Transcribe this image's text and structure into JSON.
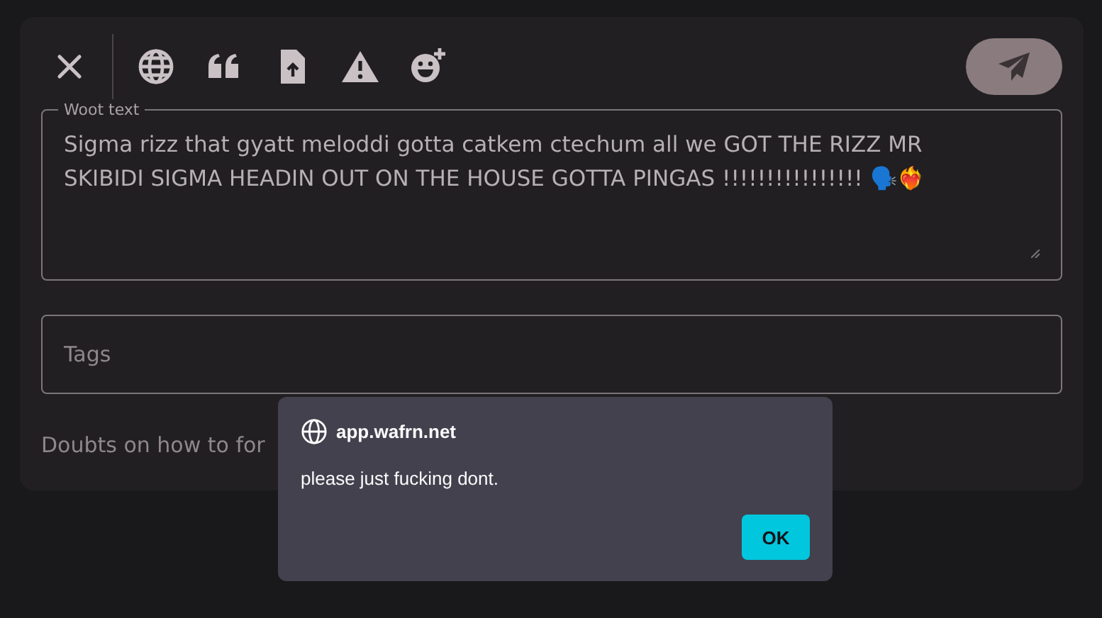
{
  "editor": {
    "text_label": "Woot text",
    "text": "Sigma rizz that gyatt meloddi gotta catkem ctechum all we GOT THE RIZZ MR SKIBIDI SIGMA HEADIN OUT ON THE HOUSE GOTTA PINGAS !!!!!!!!!!!!!!!! 🗣️❤️‍🔥",
    "tags_placeholder": "Tags",
    "help_text": "Doubts on how to for"
  },
  "dialog": {
    "origin": "app.wafrn.net",
    "message": "please just fucking dont.",
    "button": "OK"
  }
}
